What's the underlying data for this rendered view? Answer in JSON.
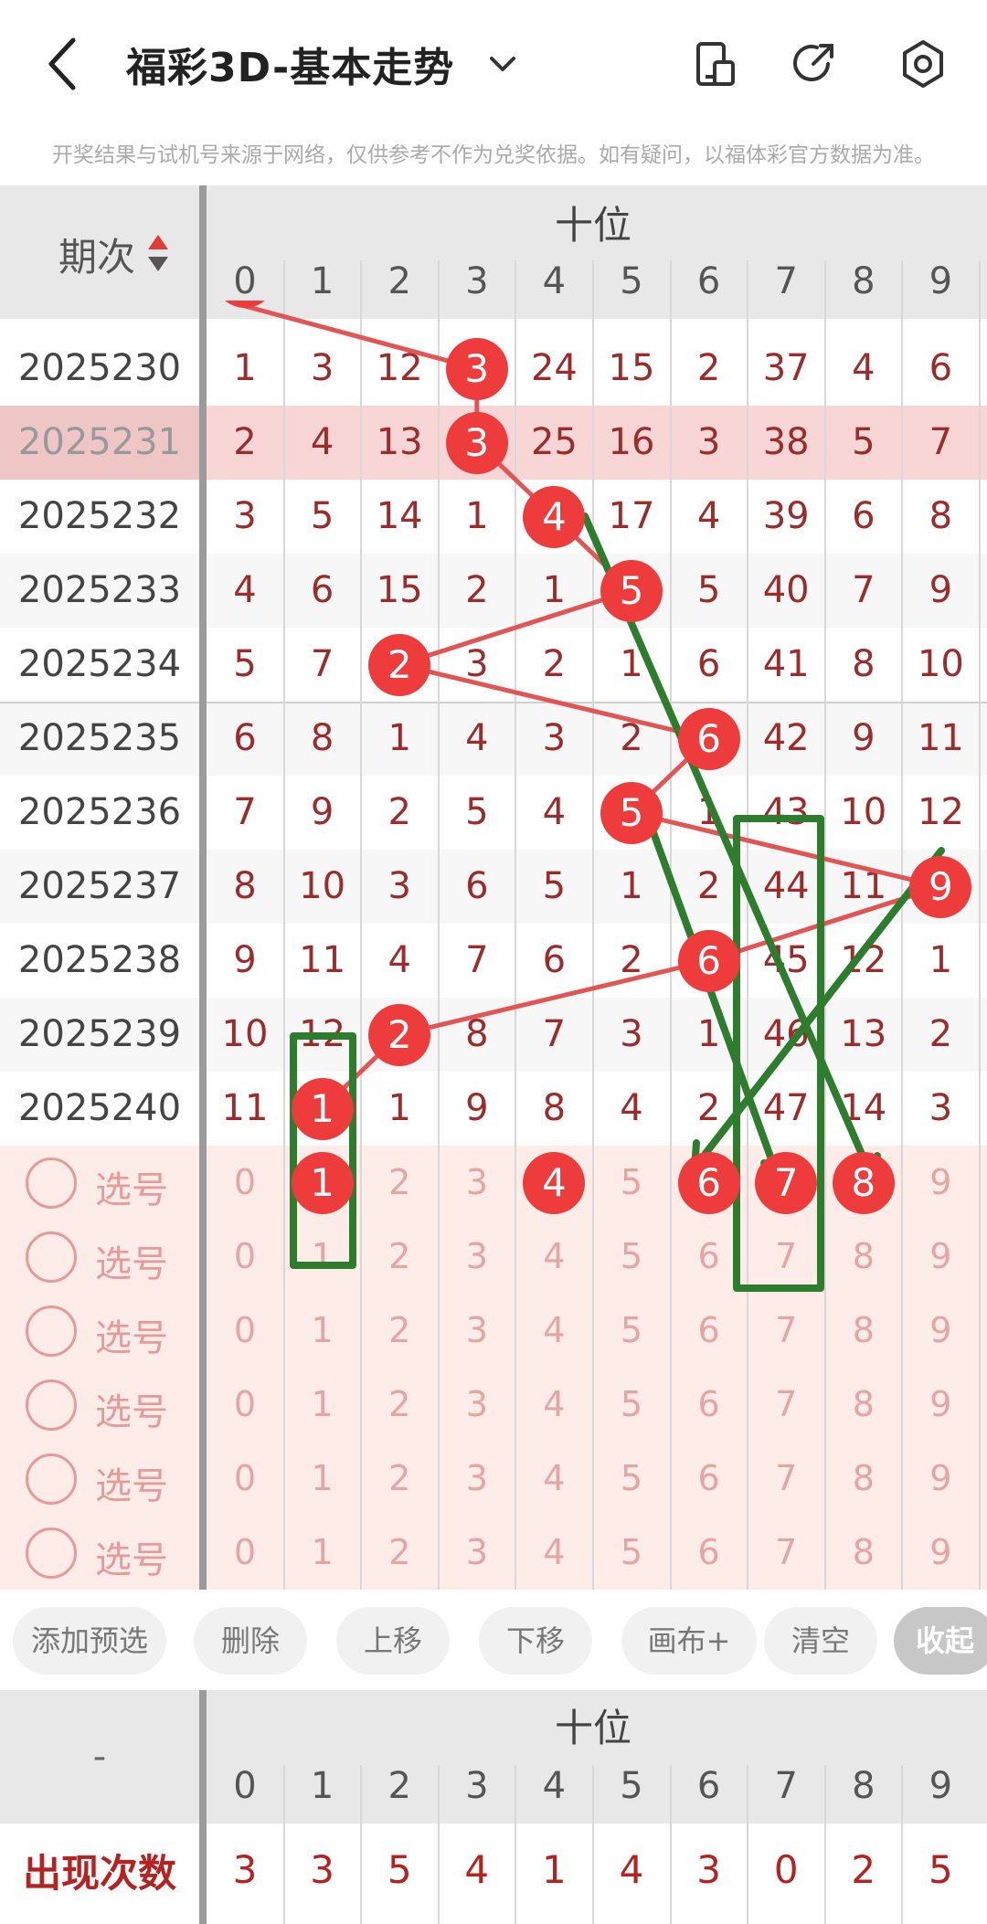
{
  "header": {
    "title": "福彩3D-基本走势",
    "icons": [
      "back-arrow-icon",
      "chevron-down-icon",
      "phone-icon",
      "share-icon",
      "settings-icon"
    ]
  },
  "notice": "开奖结果与试机号来源于网络，仅供参考不作为兑奖依据。如有疑问，以福体彩官方数据为准。",
  "grid": {
    "period_label": "期次",
    "group_label": "十位",
    "columns": [
      "0",
      "1",
      "2",
      "3",
      "4",
      "5",
      "6",
      "7",
      "8",
      "9"
    ],
    "rows": [
      {
        "period": "2025230",
        "cells": [
          "1",
          "3",
          "12",
          "3",
          "24",
          "15",
          "2",
          "37",
          "4",
          "6"
        ],
        "hit": 3
      },
      {
        "period": "2025231",
        "cells": [
          "2",
          "4",
          "13",
          "3",
          "25",
          "16",
          "3",
          "38",
          "5",
          "7"
        ],
        "hit": 3,
        "highlight": true
      },
      {
        "period": "2025232",
        "cells": [
          "3",
          "5",
          "14",
          "1",
          "4",
          "17",
          "4",
          "39",
          "6",
          "8"
        ],
        "hit": 4
      },
      {
        "period": "2025233",
        "cells": [
          "4",
          "6",
          "15",
          "2",
          "1",
          "5",
          "5",
          "40",
          "7",
          "9"
        ],
        "hit": 5
      },
      {
        "period": "2025234",
        "cells": [
          "5",
          "7",
          "2",
          "3",
          "2",
          "1",
          "6",
          "41",
          "8",
          "10"
        ],
        "hit": 2
      },
      {
        "period": "2025235",
        "cells": [
          "6",
          "8",
          "1",
          "4",
          "3",
          "2",
          "6",
          "42",
          "9",
          "11"
        ],
        "hit": 6
      },
      {
        "period": "2025236",
        "cells": [
          "7",
          "9",
          "2",
          "5",
          "4",
          "5",
          "1",
          "43",
          "10",
          "12"
        ],
        "hit": 5
      },
      {
        "period": "2025237",
        "cells": [
          "8",
          "10",
          "3",
          "6",
          "5",
          "1",
          "2",
          "44",
          "11",
          "9"
        ],
        "hit": 9
      },
      {
        "period": "2025238",
        "cells": [
          "9",
          "11",
          "4",
          "7",
          "6",
          "2",
          "6",
          "45",
          "12",
          "1"
        ],
        "hit": 6
      },
      {
        "period": "2025239",
        "cells": [
          "10",
          "12",
          "2",
          "8",
          "7",
          "3",
          "1",
          "46",
          "13",
          "2"
        ],
        "hit": 2
      },
      {
        "period": "2025240",
        "cells": [
          "11",
          "1",
          "1",
          "9",
          "8",
          "4",
          "2",
          "47",
          "14",
          "3"
        ],
        "hit": 1
      }
    ],
    "pick_label": "选号",
    "pick_rows": [
      {
        "selected": [
          1,
          4,
          6,
          7,
          8
        ]
      },
      {
        "selected": []
      },
      {
        "selected": []
      },
      {
        "selected": []
      },
      {
        "selected": []
      },
      {
        "selected": []
      }
    ]
  },
  "toolbar": {
    "buttons": [
      "添加预选",
      "删除",
      "上移",
      "下移",
      "画布+",
      "清空",
      "收起"
    ]
  },
  "stats": {
    "left_label": "-",
    "group_label": "十位",
    "columns": [
      "0",
      "1",
      "2",
      "3",
      "4",
      "5",
      "6",
      "7",
      "8",
      "9"
    ],
    "row_label": "出现次数",
    "values": [
      "3",
      "3",
      "5",
      "4",
      "1",
      "4",
      "3",
      "0",
      "2",
      "5"
    ]
  },
  "colors": {
    "ball": "#ee3b3b",
    "trend_line": "#e25555",
    "annotation": "#2e7d2e",
    "pick_bg": "#fdece8",
    "highlight_row": "#f9d6d6"
  }
}
